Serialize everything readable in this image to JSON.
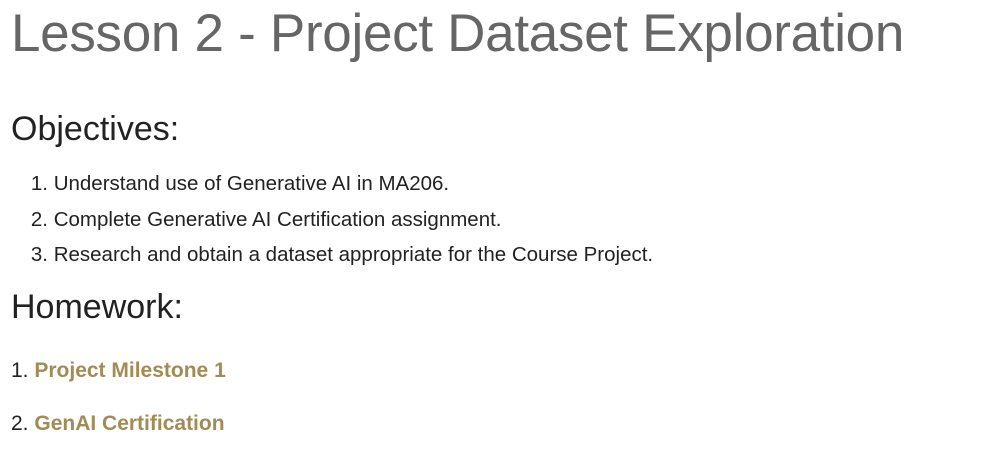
{
  "page": {
    "title": "Lesson 2 - Project Dataset Exploration"
  },
  "objectives": {
    "heading": "Objectives:",
    "items": [
      {
        "number": "1.",
        "text": "Understand use of Generative AI in MA206."
      },
      {
        "number": "2.",
        "text": "Complete Generative AI Certification assignment."
      },
      {
        "number": "3.",
        "text": "Research and obtain a dataset appropriate for the Course Project."
      }
    ]
  },
  "homework": {
    "heading": "Homework:",
    "items": [
      {
        "number": "1.",
        "link_text": "Project Milestone 1"
      },
      {
        "number": "2.",
        "link_text": "GenAI Certification"
      }
    ]
  },
  "colors": {
    "title": "#666666",
    "text": "#222222",
    "link": "#a28b55"
  }
}
